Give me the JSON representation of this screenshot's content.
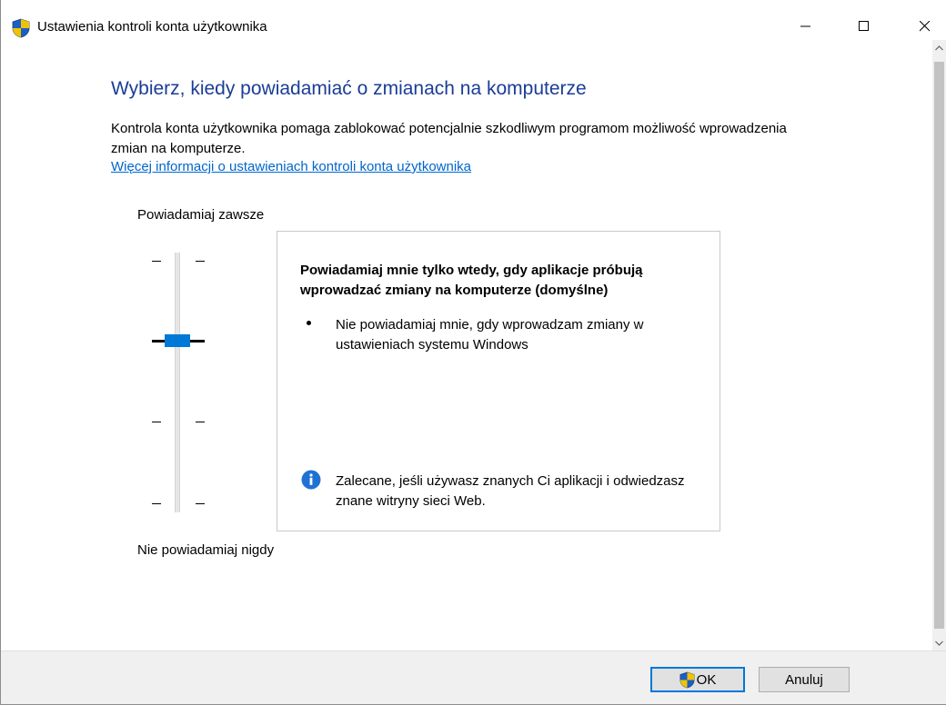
{
  "window": {
    "title": "Ustawienia kontroli konta użytkownika",
    "icon": "uac-shield-icon"
  },
  "content": {
    "heading": "Wybierz, kiedy powiadamiać o zmianach na komputerze",
    "description": "Kontrola konta użytkownika pomaga zablokować potencjalnie szkodliwym programom możliwość wprowadzenia zmian na komputerze.",
    "more_link": "Więcej informacji o ustawieniach kontroli konta użytkownika",
    "slider_top_label": "Powiadamiaj zawsze",
    "slider_bottom_label": "Nie powiadamiaj nigdy",
    "slider_level": 3,
    "slider_levels_total": 4
  },
  "infobox": {
    "title": "Powiadamiaj mnie tylko wtedy, gdy aplikacje próbują wprowadzać zmiany na komputerze (domyślne)",
    "bullet": "Nie powiadamiaj mnie, gdy wprowadzam zmiany w ustawieniach systemu Windows",
    "recommendation": "Zalecane, jeśli używasz znanych Ci aplikacji i odwiedzasz znane witryny sieci Web."
  },
  "buttons": {
    "ok_label": "OK",
    "cancel_label": "Anuluj"
  },
  "colors": {
    "heading": "#1a3d96",
    "link": "#0066cc",
    "accent": "#0078d7"
  }
}
